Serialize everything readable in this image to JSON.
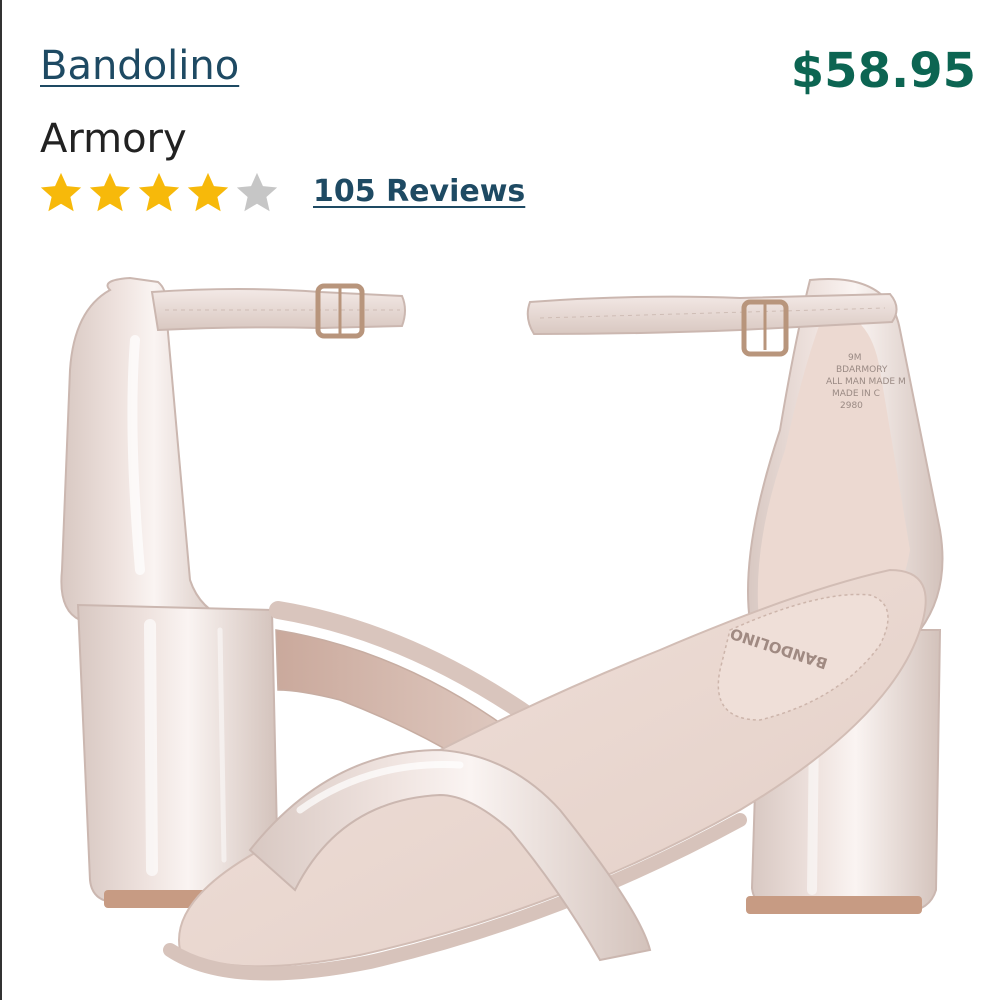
{
  "product": {
    "brand": "Bandolino",
    "name": "Armory",
    "price": "$58.95",
    "rating": {
      "value": 4,
      "max": 5
    },
    "reviews_label": "105 Reviews",
    "image_alt_marks": {
      "insole_brand_stamp": "BANDOLINO",
      "label_lines": [
        "9M",
        "BDARMORY",
        "ALL MAN MADE M",
        "MADE IN C",
        "2980"
      ]
    }
  },
  "colors": {
    "brand_link": "#1e4a63",
    "price": "#0c6552",
    "star_filled": "#f7b90a",
    "star_empty": "#c6c6c6"
  },
  "icons": {
    "star": "star-icon"
  }
}
